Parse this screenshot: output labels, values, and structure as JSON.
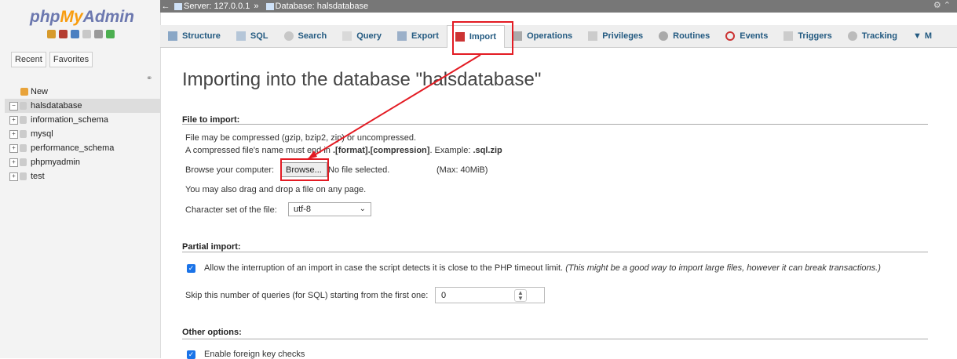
{
  "sidebar": {
    "logo_php": "php",
    "logo_my": "My",
    "logo_admin": "Admin",
    "tabs": [
      "Recent",
      "Favorites"
    ],
    "tree": [
      {
        "label": "New",
        "type": "new"
      },
      {
        "label": "halsdatabase",
        "type": "db",
        "active": true
      },
      {
        "label": "information_schema",
        "type": "db"
      },
      {
        "label": "mysql",
        "type": "db"
      },
      {
        "label": "performance_schema",
        "type": "db"
      },
      {
        "label": "phpmyadmin",
        "type": "db"
      },
      {
        "label": "test",
        "type": "db"
      }
    ]
  },
  "topbar": {
    "server": "Server: 127.0.0.1",
    "separator": "»",
    "database": "Database: halsdatabase"
  },
  "tabs": [
    "Structure",
    "SQL",
    "Search",
    "Query",
    "Export",
    "Import",
    "Operations",
    "Privileges",
    "Routines",
    "Events",
    "Triggers",
    "Tracking",
    "M"
  ],
  "main": {
    "title": "Importing into the database \"halsdatabase\"",
    "file_section": {
      "title": "File to import:",
      "line1": "File may be compressed (gzip, bzip2, zip) or uncompressed.",
      "line2_pre": "A compressed file's name must end in ",
      "line2_bold": ".[format].[compression]",
      "line2_mid": ". Example: ",
      "line2_ex": ".sql.zip",
      "browse_label": "Browse your computer:",
      "browse_button": "Browse...",
      "no_file": "No file selected.",
      "max": "(Max: 40MiB)",
      "drag_text": "You may also drag and drop a file on any page.",
      "charset_label": "Character set of the file:",
      "charset_value": "utf-8"
    },
    "partial_section": {
      "title": "Partial import:",
      "allow_text": "Allow the interruption of an import in case the script detects it is close to the PHP timeout limit.",
      "allow_note": "(This might be a good way to import large files, however it can break transactions.)",
      "skip_label": "Skip this number of queries (for SQL) starting from the first one:",
      "skip_value": "0"
    },
    "other_section": {
      "title": "Other options:",
      "fk_text": "Enable foreign key checks"
    }
  },
  "colors": {
    "highlight": "#e31b23",
    "link": "#235a81",
    "checkbox": "#1a73e8"
  }
}
